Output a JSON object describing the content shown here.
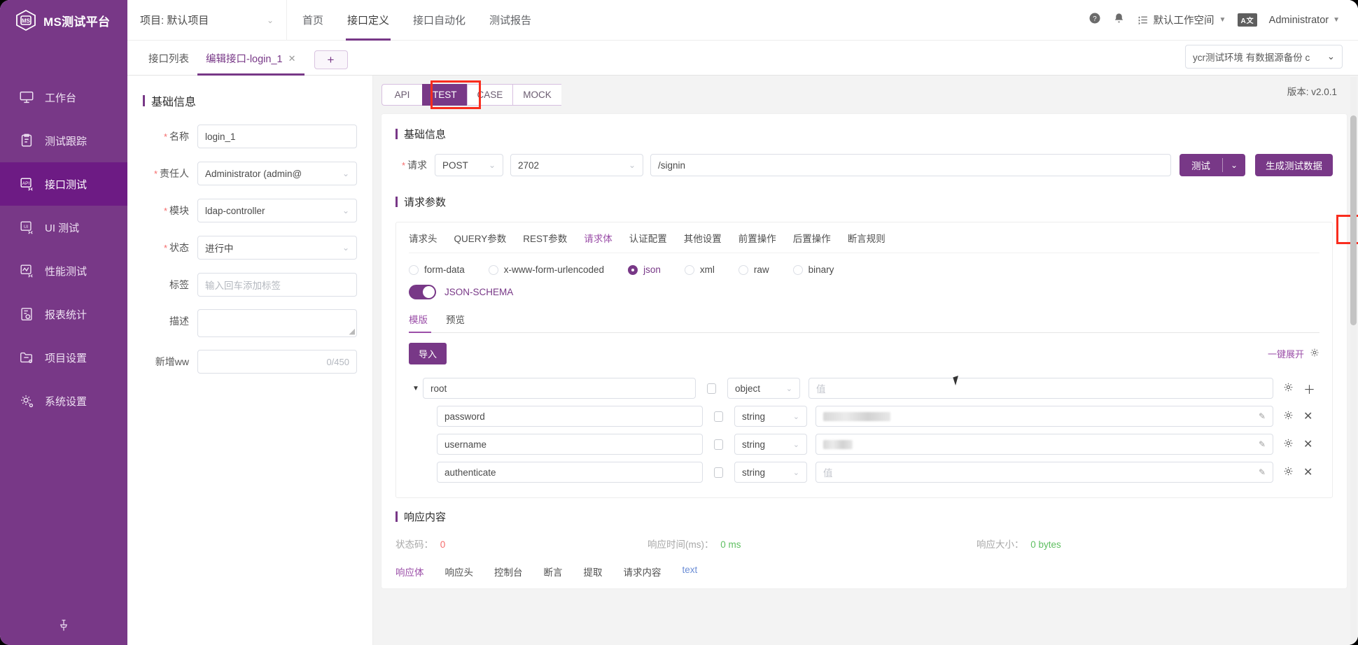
{
  "sidebar": {
    "brand": "MS测试平台",
    "items": [
      {
        "label": "工作台",
        "icon": "monitor-icon",
        "active": false
      },
      {
        "label": "测试跟踪",
        "icon": "clipboard-icon",
        "active": false
      },
      {
        "label": "接口测试",
        "icon": "api-icon",
        "active": true
      },
      {
        "label": "UI 测试",
        "icon": "ui-icon",
        "active": false
      },
      {
        "label": "性能测试",
        "icon": "performance-icon",
        "active": false
      },
      {
        "label": "报表统计",
        "icon": "report-icon",
        "active": false
      },
      {
        "label": "项目设置",
        "icon": "folder-settings-icon",
        "active": false
      },
      {
        "label": "系统设置",
        "icon": "gear-icon",
        "active": false
      }
    ]
  },
  "topbar": {
    "project": "项目: 默认项目",
    "nav": [
      {
        "label": "首页",
        "active": false
      },
      {
        "label": "接口定义",
        "active": true
      },
      {
        "label": "接口自动化",
        "active": false
      },
      {
        "label": "测试报告",
        "active": false
      }
    ],
    "workspace": "默认工作空间",
    "lang_badge": "A文",
    "user": "Administrator"
  },
  "tabstrip": {
    "tabs": [
      {
        "label": "接口列表",
        "active": false,
        "closable": false
      },
      {
        "label": "编辑接口-login_1",
        "active": true,
        "closable": true
      }
    ],
    "add_label": "+",
    "environment": "ycr测试环境 有数据源备份 c"
  },
  "version": "版本: v2.0.1",
  "left_form": {
    "title": "基础信息",
    "rows": [
      {
        "label": "名称",
        "required": true,
        "value": "login_1",
        "type": "input",
        "placeholder": ""
      },
      {
        "label": "责任人",
        "required": true,
        "value": "Administrator (admin@",
        "type": "select",
        "placeholder": ""
      },
      {
        "label": "模块",
        "required": true,
        "value": "ldap-controller",
        "type": "select",
        "placeholder": ""
      },
      {
        "label": "状态",
        "required": true,
        "value": "进行中",
        "type": "select",
        "placeholder": ""
      },
      {
        "label": "标签",
        "required": false,
        "value": "",
        "type": "input",
        "placeholder": "输入回车添加标签"
      },
      {
        "label": "描述",
        "required": false,
        "value": "",
        "type": "textarea",
        "placeholder": ""
      },
      {
        "label": "新增ww",
        "required": false,
        "value": "",
        "type": "counter",
        "placeholder": "",
        "counter": "0/450"
      }
    ]
  },
  "api_tabs": [
    {
      "label": "API",
      "active": false
    },
    {
      "label": "TEST",
      "active": true,
      "highlighted": true
    },
    {
      "label": "CASE",
      "active": false
    },
    {
      "label": "MOCK",
      "active": false
    }
  ],
  "basic_info": {
    "title": "基础信息",
    "request_label": "请求",
    "method": "POST",
    "port": "2702",
    "path": "/signin",
    "run_button": "测试",
    "run_button_highlighted": true,
    "generate_button": "生成测试数据"
  },
  "request_params": {
    "title": "请求参数",
    "tabs": [
      {
        "label": "请求头",
        "active": false
      },
      {
        "label": "QUERY参数",
        "active": false
      },
      {
        "label": "REST参数",
        "active": false
      },
      {
        "label": "请求体",
        "active": true
      },
      {
        "label": "认证配置",
        "active": false
      },
      {
        "label": "其他设置",
        "active": false
      },
      {
        "label": "前置操作",
        "active": false
      },
      {
        "label": "后置操作",
        "active": false
      },
      {
        "label": "断言规则",
        "active": false
      }
    ],
    "body_types": [
      {
        "label": "form-data",
        "selected": false
      },
      {
        "label": "x-www-form-urlencoded",
        "selected": false
      },
      {
        "label": "json",
        "selected": true
      },
      {
        "label": "xml",
        "selected": false
      },
      {
        "label": "raw",
        "selected": false
      },
      {
        "label": "binary",
        "selected": false
      }
    ],
    "schema_toggle": {
      "label": "JSON-SCHEMA",
      "on": true
    },
    "sub_tabs": [
      {
        "label": "模版",
        "active": true
      },
      {
        "label": "预览",
        "active": false
      }
    ],
    "import_button": "导入",
    "expand_all": "一键展开",
    "tree": [
      {
        "name": "root",
        "level": 0,
        "checked": false,
        "type": "object",
        "value": "",
        "value_placeholder": "值",
        "masked": false,
        "expanded": true,
        "actions": [
          "gear",
          "plus"
        ]
      },
      {
        "name": "password",
        "level": 1,
        "checked": false,
        "type": "string",
        "value": "",
        "value_placeholder": "",
        "masked": true,
        "actions": [
          "gear",
          "close"
        ]
      },
      {
        "name": "username",
        "level": 1,
        "checked": false,
        "type": "string",
        "value": "",
        "value_placeholder": "",
        "masked": true,
        "actions": [
          "gear",
          "close"
        ]
      },
      {
        "name": "authenticate",
        "level": 1,
        "checked": false,
        "type": "string",
        "value": "",
        "value_placeholder": "值",
        "masked": false,
        "actions": [
          "gear",
          "close"
        ]
      }
    ]
  },
  "response": {
    "title": "响应内容",
    "status_code_label": "状态码：",
    "status_code_value": "0",
    "time_label": "响应时间(ms)：",
    "time_value": "0 ms",
    "size_label": "响应大小：",
    "size_value": "0 bytes",
    "tabs": [
      {
        "label": "响应体",
        "active": true
      },
      {
        "label": "响应头",
        "active": false
      },
      {
        "label": "控制台",
        "active": false
      },
      {
        "label": "断言",
        "active": false
      },
      {
        "label": "提取",
        "active": false
      },
      {
        "label": "请求内容",
        "active": false
      }
    ],
    "format": "text"
  },
  "colors": {
    "brand_purple": "#783887",
    "accent_purple": "#9b4fa8",
    "highlight_red": "#f92d1e",
    "status_red": "#f56c6c",
    "status_green": "#5fbf61"
  }
}
